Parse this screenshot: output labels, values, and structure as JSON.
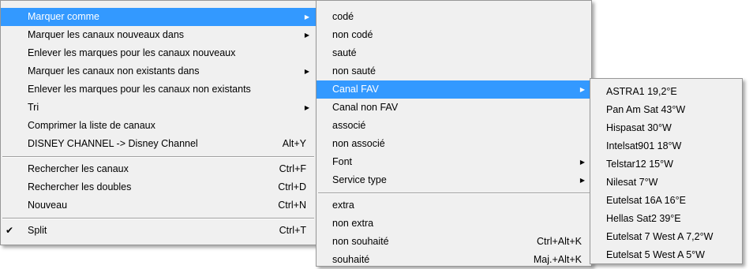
{
  "menu1": {
    "items": [
      {
        "label": "Marquer comme",
        "submenu": true,
        "selected": true
      },
      {
        "label": "Marquer les canaux nouveaux dans",
        "submenu": true
      },
      {
        "label": "Enlever les marques pour les canaux nouveaux"
      },
      {
        "label": "Marquer les canaux non existants dans",
        "submenu": true
      },
      {
        "label": "Enlever les marques pour les canaux non existants"
      },
      {
        "label": "Tri",
        "submenu": true
      },
      {
        "label": "Comprimer la liste de canaux"
      },
      {
        "label": "DISNEY CHANNEL -> Disney Channel",
        "shortcut": "Alt+Y"
      },
      {
        "label": "Rechercher les canaux",
        "shortcut": "Ctrl+F"
      },
      {
        "label": "Rechercher les doubles",
        "shortcut": "Ctrl+D"
      },
      {
        "label": "Nouveau",
        "shortcut": "Ctrl+N"
      },
      {
        "label": "Split",
        "shortcut": "Ctrl+T",
        "checked": true
      }
    ]
  },
  "menu2": {
    "items": [
      {
        "label": "codé"
      },
      {
        "label": "non codé"
      },
      {
        "label": "sauté"
      },
      {
        "label": "non sauté"
      },
      {
        "label": "Canal FAV",
        "submenu": true,
        "selected": true
      },
      {
        "label": "Canal non FAV"
      },
      {
        "label": "associé"
      },
      {
        "label": "non associé"
      },
      {
        "label": "Font",
        "submenu": true
      },
      {
        "label": "Service type",
        "submenu": true
      },
      {
        "label": "extra"
      },
      {
        "label": "non extra"
      },
      {
        "label": "non souhaité",
        "shortcut": "Ctrl+Alt+K"
      },
      {
        "label": "souhaité",
        "shortcut": "Maj.+Alt+K"
      }
    ]
  },
  "menu3": {
    "items": [
      {
        "label": "ASTRA1 19,2°E"
      },
      {
        "label": "Pan Am Sat 43°W"
      },
      {
        "label": "Hispasat 30°W"
      },
      {
        "label": "Intelsat901 18°W"
      },
      {
        "label": "Telstar12 15°W"
      },
      {
        "label": "Nilesat 7°W"
      },
      {
        "label": "Eutelsat 16A 16°E"
      },
      {
        "label": "Hellas Sat2 39°E"
      },
      {
        "label": "Eutelsat 7 West A 7,2°W"
      },
      {
        "label": "Eutelsat 5 West A 5°W"
      }
    ]
  },
  "icons": {
    "submenu": "triangle-right-icon",
    "check": "check-icon"
  },
  "colors": {
    "selection": "#3399ff",
    "menu_bg": "#f0f0f0"
  }
}
